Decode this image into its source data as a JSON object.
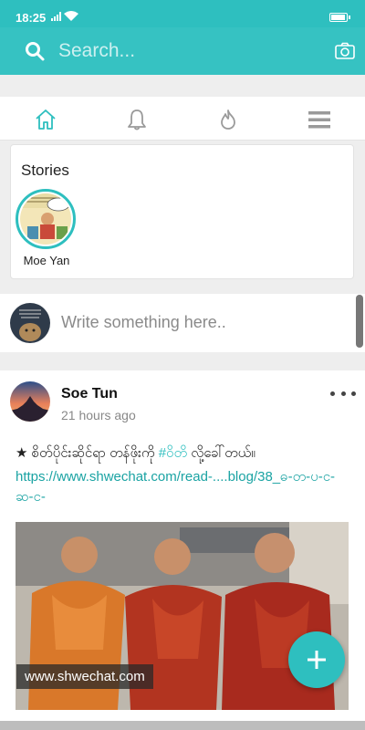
{
  "status_bar": {
    "time": "18:25"
  },
  "search": {
    "placeholder": "Search..."
  },
  "nav": {
    "tabs": [
      "home",
      "notifications",
      "trending",
      "menu"
    ]
  },
  "stories": {
    "title": "Stories",
    "items": [
      {
        "name": "Moe Yan"
      }
    ]
  },
  "compose": {
    "placeholder": "Write something here.."
  },
  "post": {
    "author": "Soe Tun",
    "time": "21 hours ago",
    "text_prefix": "★ စိတ်ပိုင်းဆိုင်ရာ တန်ဖိုးကို ",
    "hashtag": "#ဝိတိ",
    "text_suffix": " လို့ခေါ်တယ်။",
    "link": "https://www.shwechat.com/read-....blog/38_ဓ-တ-ပ-င-ဆ-င-",
    "watermark": "www.shwechat.com"
  },
  "colors": {
    "accent": "#2ebfbf",
    "header": "#36c2c2"
  }
}
